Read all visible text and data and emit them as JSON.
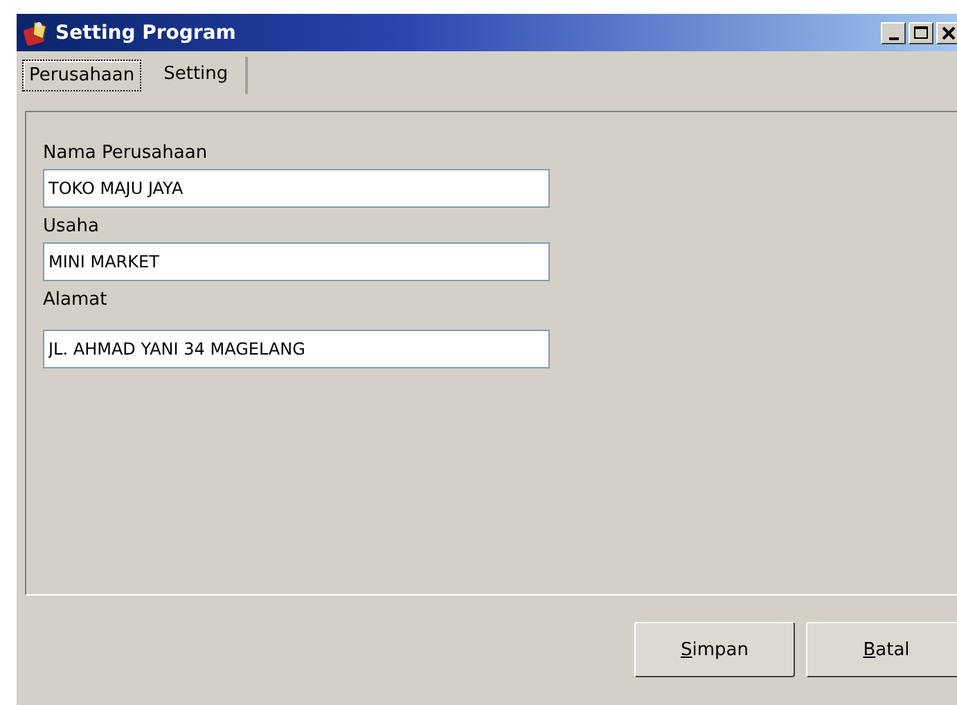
{
  "window": {
    "title": "Setting Program"
  },
  "tabs": [
    {
      "label": "Perusahaan",
      "selected": true
    },
    {
      "label": "Setting",
      "selected": false
    }
  ],
  "fields": [
    {
      "label": "Nama Perusahaan",
      "value": "TOKO MAJU JAYA"
    },
    {
      "label": "Usaha",
      "value": "MINI MARKET"
    },
    {
      "label": "Alamat",
      "value": "JL. AHMAD YANI 34 MAGELANG"
    }
  ],
  "buttons": [
    "Simpan",
    "Batal"
  ]
}
